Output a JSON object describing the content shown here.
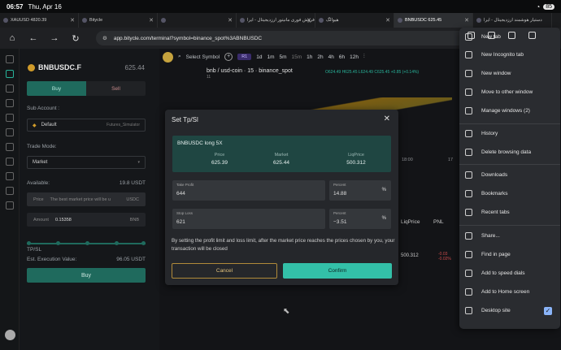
{
  "status": {
    "time": "06:57",
    "date": "Thu, Apr 16",
    "battery": "85"
  },
  "tabs": [
    {
      "title": "XAUUSD 4820.39"
    },
    {
      "title": "Bitycle"
    },
    {
      "title": ""
    },
    {
      "title": "فروش فوری مانیتور ارزدیجیتال - ایرا"
    },
    {
      "title": "هیوالگ"
    },
    {
      "title": "BNBUSDC 625.45"
    },
    {
      "title": "دستیار هوشمند ارزدیجیتال - ایرا"
    }
  ],
  "address": {
    "url": "app.bitycle.com/terminal?symbol=binance_spot%3ABNBUSDC"
  },
  "panel": {
    "pair": "BNBUSDC.F",
    "price": "625.44",
    "buy": "Buy",
    "sell": "Sell",
    "sub_account_label": "Sub Account :",
    "sub_account_value": "Default",
    "sub_account_tag": "Futures_Simulator",
    "trade_mode_label": "Trade Mode:",
    "trade_mode_value": "Market",
    "available_label": "Available:",
    "available_value": "19.8 USDT",
    "price_label": "Price",
    "price_placeholder": "The best market price will be u",
    "price_unit": "USDC",
    "amount_label": "Amount",
    "amount_value": "0.15358",
    "amount_unit": "BNB",
    "tpsl_label": "TP/SL",
    "exec_label": "Est. Execution Value:",
    "exec_value": "96.05 USDT",
    "buy_button": "Buy"
  },
  "chart": {
    "select_symbol": "Select Symbol",
    "r1": "R1",
    "timeframes": [
      "1d",
      "1m",
      "5m",
      "15m",
      "1h",
      "2h",
      "4h",
      "6h",
      "12h"
    ],
    "symbol": "bnb / usd-coin · 15 · binance_spot",
    "ohlc": "O624.49 H625.45 L624.49 C625.45 +0.85 (+0.14%)",
    "sub": "11",
    "time_ticks": [
      "18:00",
      "17"
    ],
    "col_liqprice": "LiqPrice",
    "col_pnl": "PNL",
    "row_liq": "500.312",
    "row_pnl_1": "-0.03",
    "row_pnl_2": "-0.02%"
  },
  "modal": {
    "title": "Set Tp/Sl",
    "position": "BNBUSDC long 5X",
    "price_label": "Price",
    "price_value": "625.39",
    "market_label": "Market",
    "market_value": "625.44",
    "liq_label": "LiqPrice",
    "liq_value": "500.312",
    "tp_label": "Take Profit",
    "tp_value": "644",
    "tp_pct_label": "Percent",
    "tp_pct_value": "14.88",
    "pct_unit": "%",
    "sl_label": "Stop Loss",
    "sl_value": "621",
    "sl_pct_label": "Percent",
    "sl_pct_value": "−3.51",
    "note": "By setting the profit limit and loss limit, after the market price reaches the prices chosen by you, your transaction will be closed",
    "cancel": "Cancel",
    "confirm": "Confirm"
  },
  "menu": {
    "items": [
      "New tab",
      "New Incognito tab",
      "New window",
      "Move to other window",
      "Manage windows (2)",
      "History",
      "Delete browsing data",
      "Downloads",
      "Bookmarks",
      "Recent tabs",
      "Share...",
      "Find in page",
      "Add to speed dials",
      "Add to Home screen",
      "Desktop site"
    ]
  }
}
